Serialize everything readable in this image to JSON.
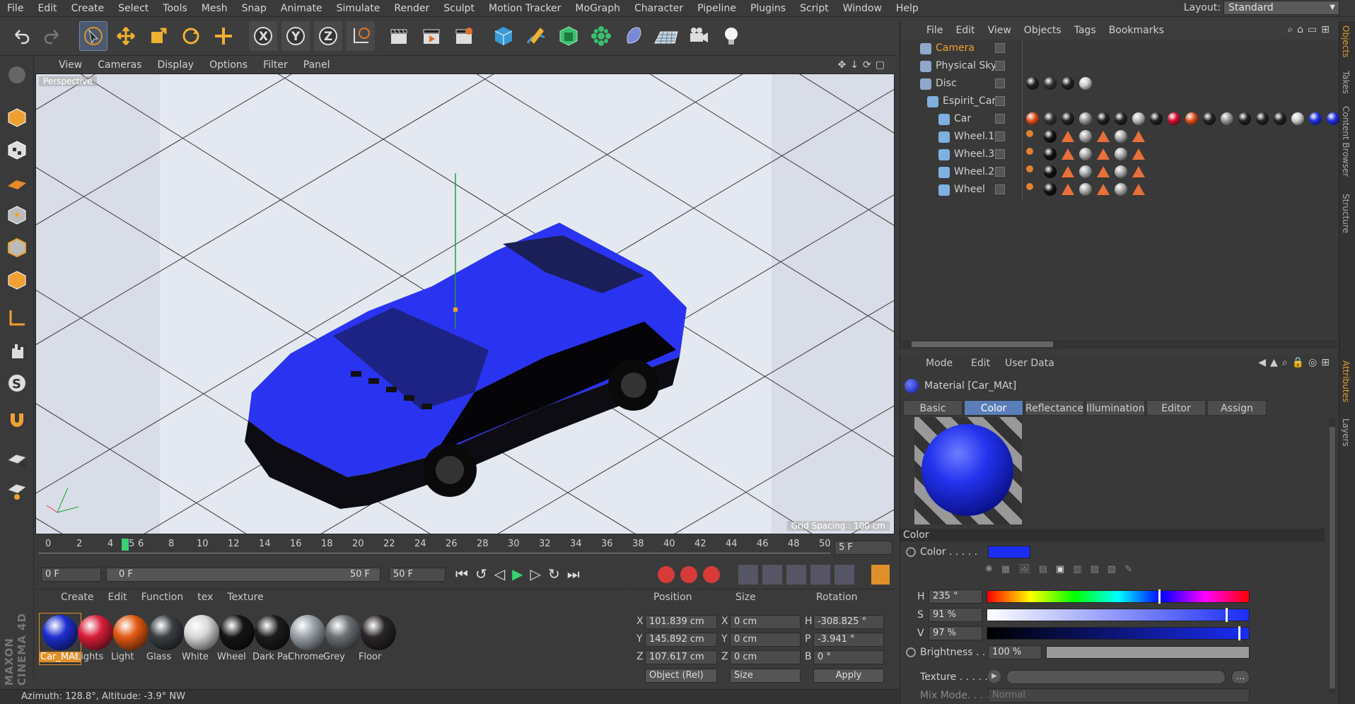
{
  "menubar": {
    "items": [
      "File",
      "Edit",
      "Create",
      "Select",
      "Tools",
      "Mesh",
      "Snap",
      "Animate",
      "Simulate",
      "Render",
      "Sculpt",
      "Motion Tracker",
      "MoGraph",
      "Character",
      "Pipeline",
      "Plugins",
      "Script",
      "Window",
      "Help"
    ],
    "layout_label": "Layout:",
    "layout_value": "Standard"
  },
  "viewport": {
    "menu": [
      "View",
      "Cameras",
      "Display",
      "Options",
      "Filter",
      "Panel"
    ],
    "label": "Perspective",
    "grid_label": "Grid Spacing : 100 cm"
  },
  "timeline": {
    "ticks": [
      "0",
      "2",
      "4",
      "5",
      "6",
      "8",
      "10",
      "12",
      "14",
      "16",
      "18",
      "20",
      "22",
      "24",
      "26",
      "28",
      "30",
      "32",
      "34",
      "36",
      "38",
      "40",
      "42",
      "44",
      "46",
      "48",
      "50"
    ],
    "end_field": "5 F"
  },
  "transport": {
    "start": "0 F",
    "range_start": "0 F",
    "range_end": "50 F",
    "end": "50 F"
  },
  "materials": {
    "menu": [
      "Create",
      "Edit",
      "Function",
      "tex",
      "Texture"
    ],
    "items": [
      {
        "name": "Car_MAt",
        "color": "#1e2fd0",
        "selected": true
      },
      {
        "name": "Lights",
        "color": "#d81e3a"
      },
      {
        "name": "Light",
        "color": "#e35a14"
      },
      {
        "name": "Glass",
        "color": "#3a3f44"
      },
      {
        "name": "White",
        "color": "#d8d8d8"
      },
      {
        "name": "Wheel",
        "color": "#151515"
      },
      {
        "name": "Dark Pai",
        "color": "#1c1c1c"
      },
      {
        "name": "Chrome",
        "color": "#9aa2a8"
      },
      {
        "name": "Grey",
        "color": "#6a7074"
      },
      {
        "name": "Floor",
        "color": "#2a2628"
      }
    ]
  },
  "coords": {
    "headers": [
      "Position",
      "Size",
      "Rotation"
    ],
    "rows": [
      {
        "a": "X",
        "pos": "101.839 cm",
        "sa": "X",
        "size": "0 cm",
        "ra": "H",
        "rot": "-308.825 °"
      },
      {
        "a": "Y",
        "pos": "145.892 cm",
        "sa": "Y",
        "size": "0 cm",
        "ra": "P",
        "rot": "-3.941 °"
      },
      {
        "a": "Z",
        "pos": "107.617 cm",
        "sa": "Z",
        "size": "0 cm",
        "ra": "B",
        "rot": "0 °"
      }
    ],
    "mode": "Object (Rel)",
    "size_mode": "Size",
    "apply": "Apply"
  },
  "status": "Azimuth: 128.8°, Altitude: -3.9°  NW",
  "objects": {
    "menu": [
      "File",
      "Edit",
      "View",
      "Objects",
      "Tags",
      "Bookmarks"
    ],
    "items": [
      {
        "name": "Camera",
        "active": true
      },
      {
        "name": "Physical Sky"
      },
      {
        "name": "Disc"
      },
      {
        "name": "Espirit_Car"
      },
      {
        "name": "Car"
      },
      {
        "name": "Wheel.1"
      },
      {
        "name": "Wheel.3"
      },
      {
        "name": "Wheel.2"
      },
      {
        "name": "Wheel"
      }
    ]
  },
  "attributes": {
    "menu": [
      "Mode",
      "Edit",
      "User Data"
    ],
    "title": "Material [Car_MAt]",
    "tabs": [
      "Basic",
      "Color",
      "Reflectance",
      "Illumination",
      "Editor",
      "Assign"
    ],
    "section": "Color",
    "color_label": "Color . . . . .",
    "h_label": "H",
    "h_value": "235 °",
    "s_label": "S",
    "s_value": "91 %",
    "v_label": "V",
    "v_value": "97 %",
    "brightness_label": "Brightness . . .",
    "brightness_value": "100 %",
    "texture_label": "Texture . . . . .",
    "mix_label": "Mix Mode. . . .",
    "mix_value": "Normal",
    "h": 235,
    "s": 0.91,
    "v": 0.97,
    "brightness": 1.0,
    "swatch": "#1a2cf5"
  },
  "sidetabs": [
    "Objects",
    "Takes",
    "Content Browser",
    "Structure",
    "Attributes",
    "Layers"
  ],
  "brand": "MAXON CINEMA 4D"
}
